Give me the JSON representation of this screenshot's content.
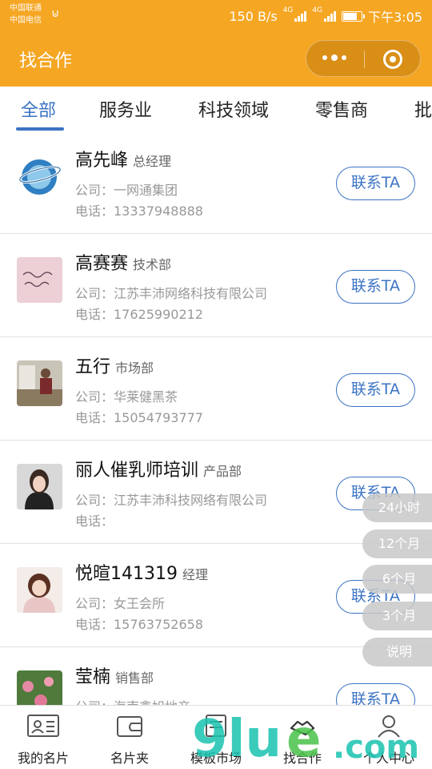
{
  "status_bar": {
    "carrier1": "中国联通",
    "carrier2": "中国电信",
    "speed": "150 B/s",
    "net1": "4G",
    "net2": "4G",
    "time": "下午3:05"
  },
  "titlebar": {
    "title": "找合作"
  },
  "tabs": [
    {
      "label": "全部",
      "active": true
    },
    {
      "label": "服务业"
    },
    {
      "label": "科技领域"
    },
    {
      "label": "零售商"
    },
    {
      "label": "批"
    }
  ],
  "contacts": [
    {
      "name": "高先峰",
      "role": "总经理",
      "company": "公司：一网通集团",
      "phone": "电话：13337948888",
      "button": "联系TA",
      "avatar": "logo-avatar"
    },
    {
      "name": "高赛赛",
      "role": "技术部",
      "company": "公司：江苏丰沛网络科技有限公司",
      "phone": "电话：17625990212",
      "button": "联系TA",
      "avatar": "handwriting-avatar"
    },
    {
      "name": "五行",
      "role": "市场部",
      "company": "公司：华莱健黑茶",
      "phone": "电话：15054793777",
      "button": "联系TA",
      "avatar": "photo-avatar"
    },
    {
      "name": "丽人催乳师培训",
      "role": "产品部",
      "company": "公司：江苏丰沛科技网络有限公司",
      "phone": "电话：",
      "button": "联系TA",
      "avatar": "woman-avatar"
    },
    {
      "name": "悦暄141319",
      "role": "经理",
      "company": "公司：女王会所",
      "phone": "电话：15763752658",
      "button": "联系TA",
      "avatar": "woman-avatar-2"
    },
    {
      "name": "莹楠",
      "role": "销售部",
      "company": "公司：海南鑫旭地产",
      "phone": "",
      "button": "联系TA",
      "avatar": "flower-avatar"
    }
  ],
  "filters": [
    "24小时",
    "12个月",
    "6个月",
    "3个月",
    "说明"
  ],
  "bottom_tabs": [
    {
      "label": "我的名片",
      "icon": "card-icon"
    },
    {
      "label": "名片夹",
      "icon": "wallet-icon"
    },
    {
      "label": "模板市场",
      "icon": "template-icon"
    },
    {
      "label": "找合作",
      "icon": "handshake-icon"
    },
    {
      "label": "个人中心",
      "icon": "person-icon"
    }
  ],
  "colors": {
    "accent": "#f5a623",
    "link": "#3b73c4"
  }
}
